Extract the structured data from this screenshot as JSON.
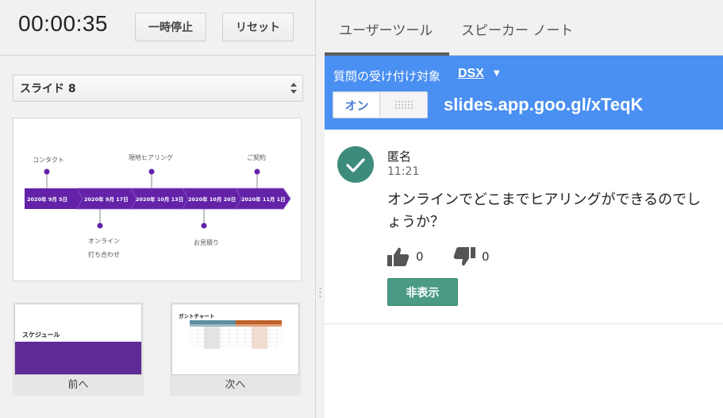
{
  "timer": {
    "value": "00:00:35",
    "pause_label": "一時停止",
    "reset_label": "リセット"
  },
  "slide_select": {
    "value": "スライド 8"
  },
  "current_slide": {
    "top_labels": [
      "コンタクト",
      "現地ヒアリング",
      "ご契約"
    ],
    "dates": [
      "2020年 9月 5日",
      "2020年 9月 17日",
      "2020年 10月 13日",
      "2020年 10月 20日",
      "2020年 11月 1日"
    ],
    "bottom_labels": [
      "オンライン",
      "打ち合わせ",
      "お見積り"
    ],
    "timeline_color": "#6322a8"
  },
  "prev_slide": {
    "title": "スケジュール",
    "label": "前へ",
    "block_color": "#5e2a96"
  },
  "next_slide": {
    "title": "ガントチャート",
    "label": "次へ"
  },
  "tabs": [
    {
      "label": "ユーザーツール",
      "active": true
    },
    {
      "label": "スピーカー ノート",
      "active": false
    }
  ],
  "qa": {
    "label": "質問の受け付け対象",
    "target": "DSX",
    "caret": "▼",
    "toggle_on": "オン",
    "url": "slides.app.goo.gl/xTeqK",
    "header_color": "#4a8ff2"
  },
  "question": {
    "author": "匿名",
    "time": "11:21",
    "text": "オンラインでどこまでヒアリングができるのでしょうか？",
    "likes": "0",
    "dislikes": "0",
    "hide_label": "非表示",
    "avatar_color": "#3d8c7b"
  }
}
